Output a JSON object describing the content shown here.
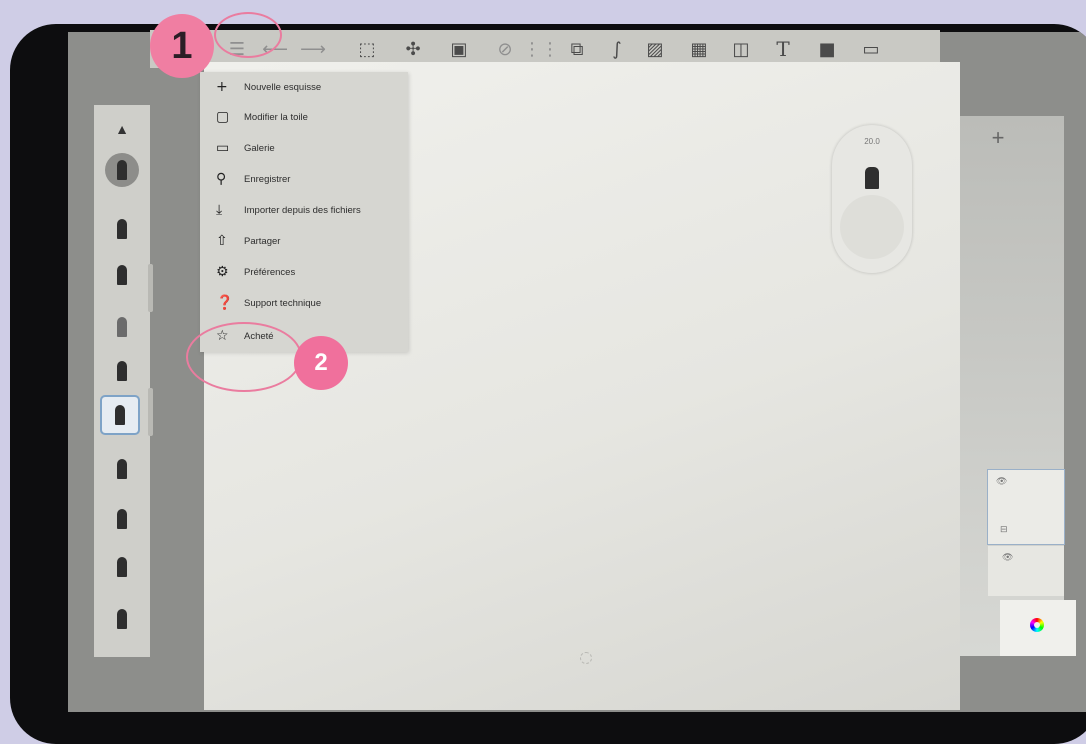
{
  "toolbar": {
    "icons": [
      "menu-icon",
      "undo-icon",
      "redo-icon",
      "selection-icon",
      "transform-icon",
      "crop-icon",
      "eraser-icon",
      "symmetry-icon",
      "shape-icon",
      "curve-icon",
      "image-icon",
      "perspective-icon",
      "flipbook-icon",
      "text-icon",
      "record-icon",
      "fullscreen-icon"
    ]
  },
  "menu": {
    "items": [
      {
        "icon": "plus-icon",
        "glyph": "+",
        "label": "Nouvelle esquisse"
      },
      {
        "icon": "canvas-resize-icon",
        "glyph": "▢",
        "label": "Modifier la toile"
      },
      {
        "icon": "gallery-icon",
        "glyph": "▭",
        "label": "Galerie"
      },
      {
        "icon": "save-icon",
        "glyph": "⚲",
        "label": "Enregistrer"
      },
      {
        "icon": "import-icon",
        "glyph": "⤓",
        "label": "Importer depuis des fichiers"
      },
      {
        "icon": "share-icon",
        "glyph": "⇧",
        "label": "Partager"
      },
      {
        "icon": "preferences-icon",
        "glyph": "⚙",
        "label": "Préférences"
      },
      {
        "icon": "help-icon",
        "glyph": "❓",
        "label": "Support technique"
      },
      {
        "icon": "star-icon",
        "glyph": "☆",
        "label": "Acheté"
      }
    ]
  },
  "brush_puck": {
    "value": "20.0"
  },
  "layers": {
    "add_label": "+"
  },
  "annotations": {
    "step1": "1",
    "step2": "2"
  }
}
